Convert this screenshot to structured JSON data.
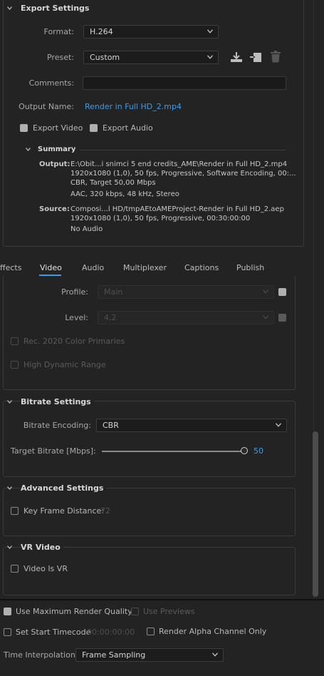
{
  "export": {
    "title": "Export Settings",
    "format_label": "Format:",
    "format_value": "H.264",
    "preset_label": "Preset:",
    "preset_value": "Custom",
    "comments_label": "Comments:",
    "comments_value": "",
    "output_name_label": "Output Name:",
    "output_name_value": "Render in Full HD_2.mp4",
    "export_video_label": "Export Video",
    "export_audio_label": "Export Audio",
    "export_video_checked": true,
    "export_audio_checked": true
  },
  "summary": {
    "title": "Summary",
    "output_label": "Output:",
    "output_lines": [
      "E:\\Obit...i snimci 5 end credits_AME\\Render in Full HD_2.mp4",
      "1920x1080 (1,0), 50 fps, Progressive, Software Encoding, 00:...",
      "CBR, Target 50,00 Mbps",
      "AAC, 320 kbps, 48 kHz, Stereo"
    ],
    "source_label": "Source:",
    "source_lines": [
      "Composi...l HD/tmpAEtoAMEProject-Render in Full HD_2.aep",
      "1920x1080 (1,0), 50 fps, Progressive, 00:30:00:00",
      "No Audio"
    ]
  },
  "tabs": [
    {
      "label": "ffects",
      "active": false
    },
    {
      "label": "Video",
      "active": true
    },
    {
      "label": "Audio",
      "active": false
    },
    {
      "label": "Multiplexer",
      "active": false
    },
    {
      "label": "Captions",
      "active": false
    },
    {
      "label": "Publish",
      "active": false
    }
  ],
  "video": {
    "profile_label": "Profile:",
    "profile_value": "Main",
    "level_label": "Level:",
    "level_value": "4.2",
    "rec2020_label": "Rec. 2020 Color Primaries",
    "hdr_label": "High Dynamic Range"
  },
  "bitrate": {
    "title": "Bitrate Settings",
    "encoding_label": "Bitrate Encoding:",
    "encoding_value": "CBR",
    "target_label": "Target Bitrate [Mbps]:",
    "target_value": "50",
    "target_fraction": 1.0
  },
  "advanced": {
    "title": "Advanced Settings",
    "keyframe_label": "Key Frame Distance:",
    "keyframe_value": "72"
  },
  "vr": {
    "title": "VR Video",
    "vr_label": "Video Is VR"
  },
  "bottom": {
    "max_quality_label": "Use Maximum Render Quality",
    "max_quality_checked": true,
    "use_previews_label": "Use Previews",
    "start_tc_label": "Set Start Timecode",
    "start_tc_value": "00:00:00:00",
    "alpha_label": "Render Alpha Channel Only",
    "interp_label": "Time Interpolation:",
    "interp_value": "Frame Sampling"
  },
  "colors": {
    "accent": "#3f9be9",
    "background": "#232323"
  },
  "icons": [
    "chevron-down-icon",
    "save-preset-icon",
    "import-preset-icon",
    "trash-icon",
    "checkbox-check-icon"
  ]
}
